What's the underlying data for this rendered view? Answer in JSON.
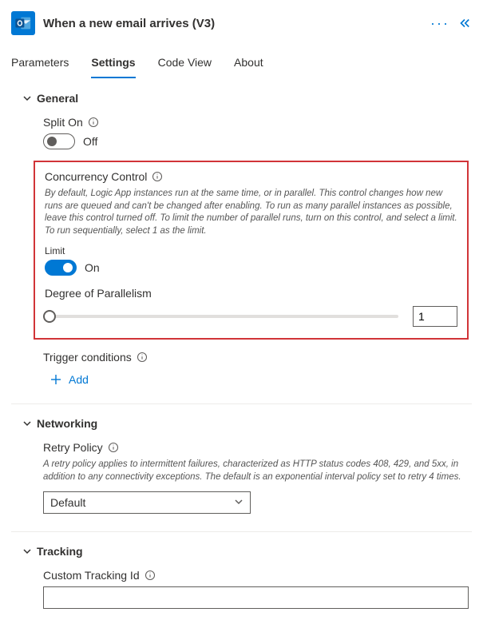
{
  "header": {
    "title": "When a new email arrives (V3)"
  },
  "tabs": {
    "items": [
      {
        "label": "Parameters",
        "active": false
      },
      {
        "label": "Settings",
        "active": true
      },
      {
        "label": "Code View",
        "active": false
      },
      {
        "label": "About",
        "active": false
      }
    ]
  },
  "general": {
    "title": "General",
    "splitOn": {
      "label": "Split On",
      "state": "Off"
    },
    "concurrency": {
      "label": "Concurrency Control",
      "description": "By default, Logic App instances run at the same time, or in parallel. This control changes how new runs are queued and can't be changed after enabling. To run as many parallel instances as possible, leave this control turned off. To limit the number of parallel runs, turn on this control, and select a limit. To run sequentially, select 1 as the limit.",
      "limitLabel": "Limit",
      "state": "On",
      "dopLabel": "Degree of Parallelism",
      "dopValue": "1"
    },
    "triggerConditions": {
      "label": "Trigger conditions",
      "addLabel": "Add"
    }
  },
  "networking": {
    "title": "Networking",
    "retry": {
      "label": "Retry Policy",
      "description": "A retry policy applies to intermittent failures, characterized as HTTP status codes 408, 429, and 5xx, in addition to any connectivity exceptions. The default is an exponential interval policy set to retry 4 times.",
      "selected": "Default"
    }
  },
  "tracking": {
    "title": "Tracking",
    "customId": {
      "label": "Custom Tracking Id",
      "value": ""
    }
  }
}
